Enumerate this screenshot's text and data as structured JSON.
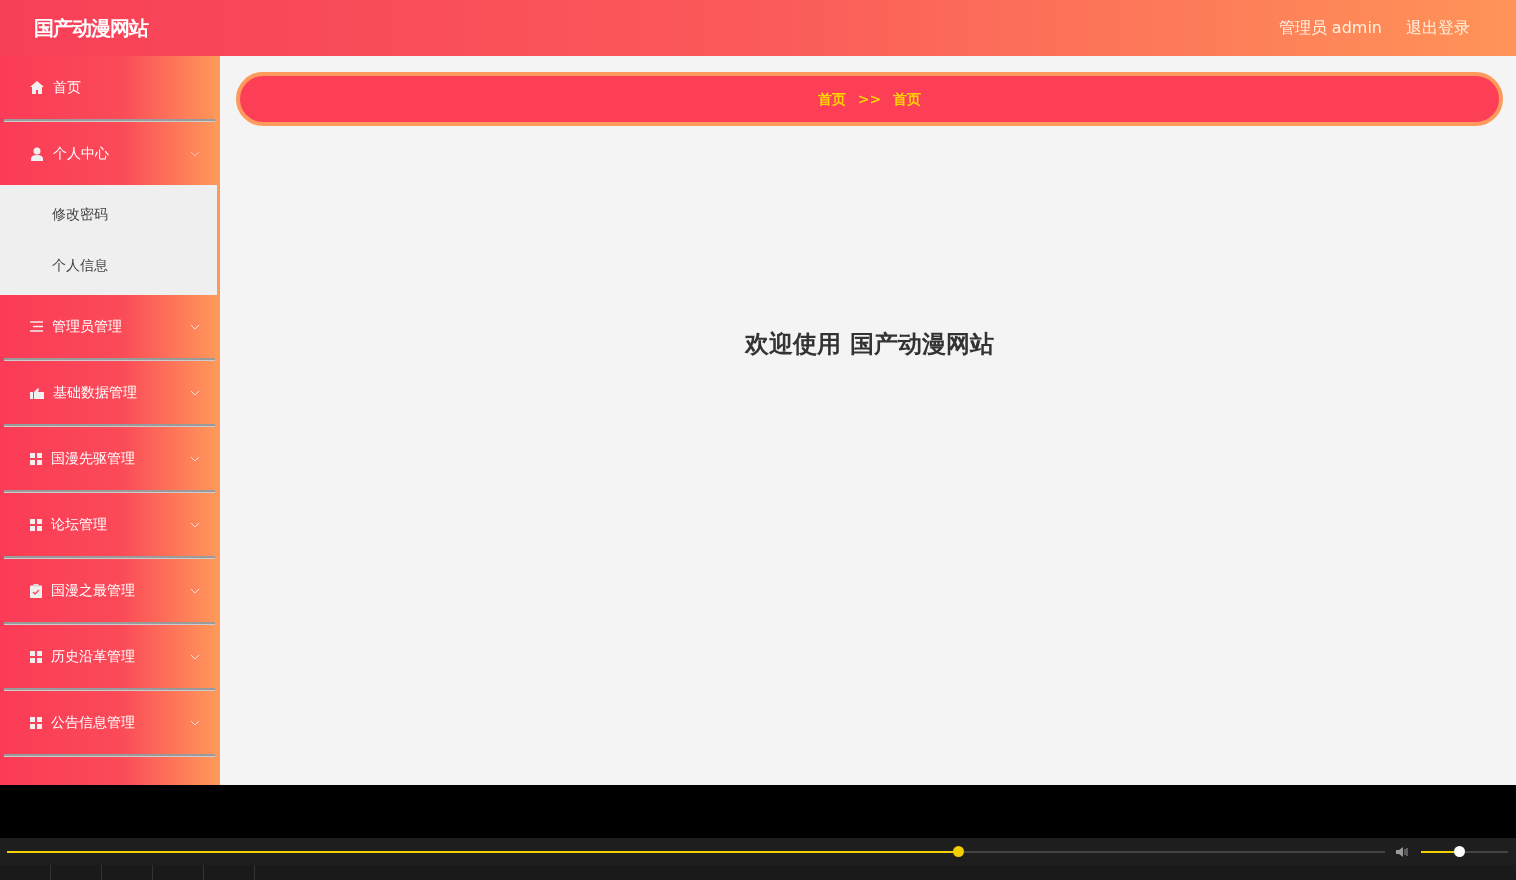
{
  "header": {
    "title": "国产动漫网站",
    "user": "管理员 admin",
    "logout": "退出登录"
  },
  "sidebar": {
    "items": [
      {
        "label": "首页",
        "kind": "link"
      },
      {
        "label": "个人中心",
        "kind": "menu",
        "expanded": true,
        "children": [
          {
            "label": "修改密码"
          },
          {
            "label": "个人信息"
          }
        ]
      },
      {
        "label": "管理员管理",
        "kind": "menu",
        "expanded": false
      },
      {
        "label": "基础数据管理",
        "kind": "menu",
        "expanded": false
      },
      {
        "label": "国漫先驱管理",
        "kind": "menu",
        "expanded": false
      },
      {
        "label": "论坛管理",
        "kind": "menu",
        "expanded": false
      },
      {
        "label": "国漫之最管理",
        "kind": "menu",
        "expanded": false
      },
      {
        "label": "历史沿革管理",
        "kind": "menu",
        "expanded": false
      },
      {
        "label": "公告信息管理",
        "kind": "menu",
        "expanded": false
      }
    ]
  },
  "breadcrumb": {
    "items": [
      "首页",
      "首页"
    ],
    "separator": ">>"
  },
  "welcome": "欢迎使用 国产动漫网站",
  "player": {
    "seek": {
      "level": 0.69
    },
    "volume": {
      "level": 0.44
    }
  }
}
